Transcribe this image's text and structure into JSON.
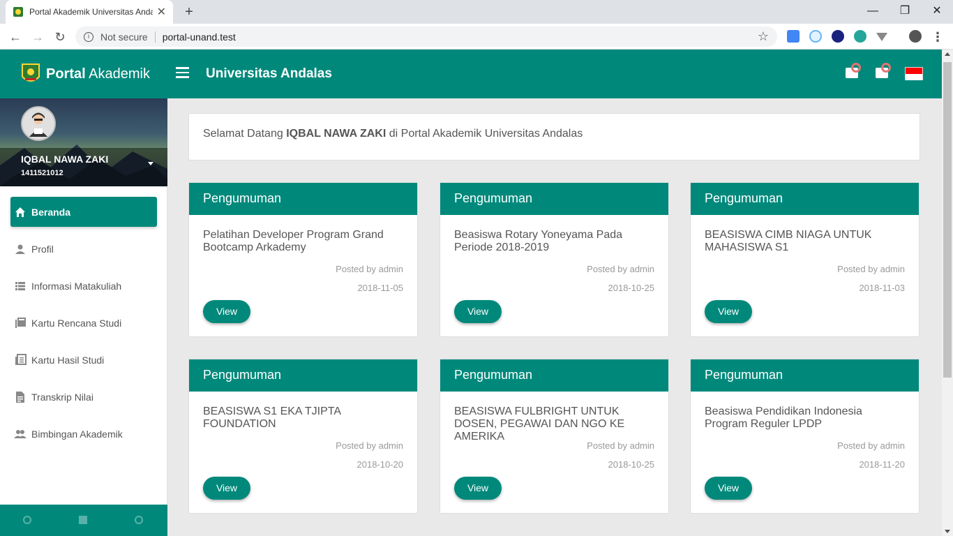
{
  "browser": {
    "tab_title": "Portal Akademik Universitas Andalas",
    "security_label": "Not secure",
    "url": "portal-unand.test"
  },
  "header": {
    "brand_bold": "Portal",
    "brand_rest": " Akademik",
    "university": "Universitas Andalas"
  },
  "user": {
    "name": "IQBAL NAWA ZAKI",
    "nim": "1411521012"
  },
  "sidebar": {
    "items": [
      {
        "label": "Beranda",
        "icon": "home-icon"
      },
      {
        "label": "Profil",
        "icon": "person-icon"
      },
      {
        "label": "Informasi Matakuliah",
        "icon": "list-icon"
      },
      {
        "label": "Kartu Rencana Studi",
        "icon": "library-books-icon"
      },
      {
        "label": "Kartu Hasil Studi",
        "icon": "chrome-reader-icon"
      },
      {
        "label": "Transkrip Nilai",
        "icon": "document-icon"
      },
      {
        "label": "Bimbingan Akademik",
        "icon": "group-icon"
      }
    ]
  },
  "welcome": {
    "prefix": "Selamat Datang ",
    "name": "IQBAL NAWA ZAKI",
    "suffix": " di Portal Akademik Universitas Andalas"
  },
  "cards": [
    {
      "header": "Pengumuman",
      "title": "Pelatihan Developer Program Grand Bootcamp Arkademy",
      "posted_by": "Posted by admin",
      "date": "2018-11-05",
      "button": "View"
    },
    {
      "header": "Pengumuman",
      "title": "Beasiswa Rotary Yoneyama Pada Periode 2018-2019",
      "posted_by": "Posted by admin",
      "date": "2018-10-25",
      "button": "View"
    },
    {
      "header": "Pengumuman",
      "title": "BEASISWA CIMB NIAGA UNTUK MAHASISWA S1",
      "posted_by": "Posted by admin",
      "date": "2018-11-03",
      "button": "View"
    },
    {
      "header": "Pengumuman",
      "title": "BEASISWA S1 EKA TJIPTA FOUNDATION",
      "posted_by": "Posted by admin",
      "date": "2018-10-20",
      "button": "View"
    },
    {
      "header": "Pengumuman",
      "title": "BEASISWA FULBRIGHT UNTUK DOSEN, PEGAWAI DAN NGO KE AMERIKA",
      "posted_by": "Posted by admin",
      "date": "2018-10-25",
      "button": "View"
    },
    {
      "header": "Pengumuman",
      "title": "Beasiswa Pendidikan Indonesia Program Reguler LPDP",
      "posted_by": "Posted by admin",
      "date": "2018-11-20",
      "button": "View"
    }
  ],
  "colors": {
    "primary": "#00897b",
    "badge": "#e57373"
  }
}
